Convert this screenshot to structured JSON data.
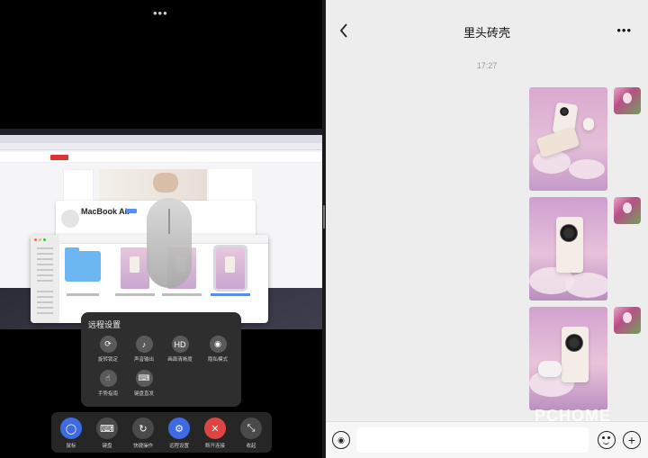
{
  "left_pane": {
    "remote_settings": {
      "title": "远程设置",
      "options": [
        {
          "label": "旋转锁定",
          "icon": "rotate-lock-icon",
          "glyph": "⟳"
        },
        {
          "label": "声音输出",
          "icon": "sound-output-icon",
          "glyph": "♪"
        },
        {
          "label": "画面清晰度",
          "icon": "resolution-icon",
          "glyph": "HD"
        },
        {
          "label": "隐私模式",
          "icon": "privacy-icon",
          "glyph": "◉"
        },
        {
          "label": "手势指南",
          "icon": "gesture-icon",
          "glyph": "☝"
        },
        {
          "label": "键盘直发",
          "icon": "keyboard-direct-icon",
          "glyph": "⌨"
        }
      ]
    },
    "controls": [
      {
        "label": "鼠标",
        "icon": "mouse-icon",
        "glyph": "◯",
        "color": "#3e6be3"
      },
      {
        "label": "键盘",
        "icon": "keyboard-icon",
        "glyph": "⌨",
        "color": "#4a4a4a"
      },
      {
        "label": "快捷操作",
        "icon": "quick-action-icon",
        "glyph": "↻",
        "color": "#4a4a4a"
      },
      {
        "label": "远程设置",
        "icon": "settings-icon",
        "glyph": "⚙",
        "color": "#3e6be3"
      },
      {
        "label": "断开连接",
        "icon": "disconnect-icon",
        "glyph": "✕",
        "color": "#e04343"
      },
      {
        "label": "收起",
        "icon": "collapse-icon",
        "glyph": "⤡",
        "color": "#4a4a4a"
      }
    ],
    "mac_screen": {
      "profile_name": "MacBook Air"
    }
  },
  "chat": {
    "title": "里头砖壳",
    "timestamp": "17:27",
    "input_placeholder": ""
  },
  "watermark": "PCHOME"
}
